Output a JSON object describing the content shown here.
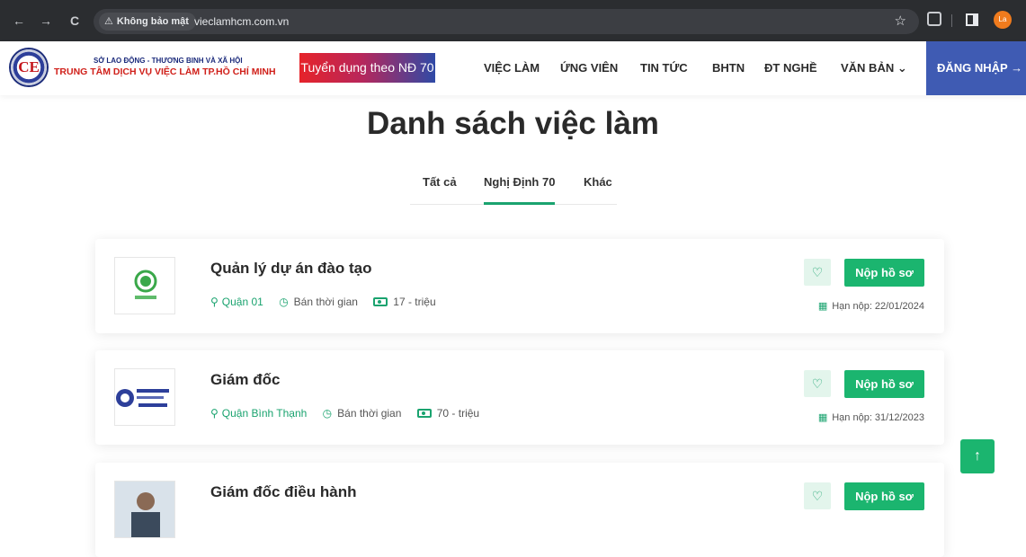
{
  "browser": {
    "back_icon": "←",
    "forward_icon": "→",
    "reload_icon": "C",
    "security_label": "Không bảo mật",
    "url": "vieclamhcm.com.vn",
    "profile_initials": "La"
  },
  "site": {
    "logo_text": "CE",
    "org_sub": "SỞ LAO ĐỘNG - THƯƠNG BINH VÀ XÃ HỘI",
    "org_main": "TRUNG TÂM DỊCH VỤ VIỆC LÀM TP.HỒ CHÍ MINH",
    "promo_label": "Tuyển dụng theo NĐ 70",
    "nav": [
      "VIỆC LÀM",
      "ỨNG VIÊN",
      "TIN TỨC",
      "BHTN",
      "ĐT NGHỀ",
      "VĂN BẢN ⌄"
    ],
    "login_label": "ĐĂNG NHẬP →"
  },
  "page": {
    "title": "Danh sách việc làm",
    "tabs": [
      "Tất cả",
      "Nghị Định 70",
      "Khác"
    ],
    "active_tab": "Nghị Định 70"
  },
  "jobs": [
    {
      "title": "Quản lý dự án đào tạo",
      "location": "Quận 01",
      "type": "Bán thời gian",
      "salary": "17 - triệu",
      "deadline": "Hạn nộp: 22/01/2024",
      "apply_label": "Nộp hồ sơ",
      "logo": "bbb-spa-logo"
    },
    {
      "title": "Giám đốc",
      "location": "Quận Bình Thạnh",
      "type": "Bán thời gian",
      "salary": "70 - triệu",
      "deadline": "Hạn nộp: 31/12/2023",
      "apply_label": "Nộp hồ sơ",
      "logo": "job-center-logo"
    },
    {
      "title": "Giám đốc điều hành",
      "apply_label": "Nộp hồ sơ",
      "logo": "person-photo"
    }
  ],
  "colors": {
    "accent_green": "#1bb56f",
    "login_blue": "#3f5bb3",
    "promo_red": "#e6232a"
  },
  "icons": {
    "scroll_top": "↑",
    "favorite": "♡",
    "location": "map-pin-icon",
    "clock": "clock-icon",
    "cash": "cash-icon",
    "calendar": "calendar-icon"
  }
}
